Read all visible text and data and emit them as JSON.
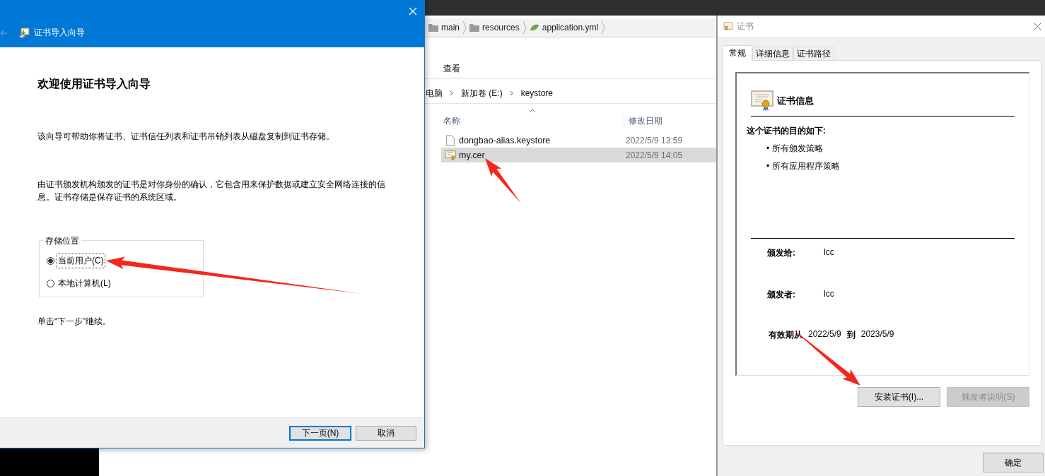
{
  "wizard": {
    "title": "证书导入向导",
    "heading": "欢迎使用证书导入向导",
    "intro": "该向导可帮助你将证书、证书信任列表和证书吊销列表从磁盘复制到证书存储。",
    "description": "由证书颁发机构颁发的证书是对你身份的确认，它包含用来保护数据或建立安全网络连接的信息。证书存储是保存证书的系统区域。",
    "store_location": {
      "label": "存储位置",
      "options": [
        {
          "label": "当前用户(C)",
          "selected": true
        },
        {
          "label": "本地计算机(L)",
          "selected": false
        }
      ]
    },
    "hint": "单击“下一步”继续。",
    "buttons": [
      {
        "label": "下一页(N)",
        "default": true
      },
      {
        "label": "取消",
        "default": false
      }
    ]
  },
  "explorer": {
    "breadcrumb": [
      "main",
      "resources",
      "application.yml"
    ],
    "menu": [
      "查看"
    ],
    "path": [
      "电脑",
      "新加卷 (E:)",
      "keystore"
    ],
    "columns": [
      "名称",
      "修改日期"
    ],
    "files": [
      {
        "name": "dongbao-alias.keystore",
        "date": "2022/5/9 13:59",
        "kind": "file",
        "selected": false
      },
      {
        "name": "my.cer",
        "date": "2022/5/9 14:05",
        "kind": "certificate",
        "selected": true
      }
    ]
  },
  "certificate": {
    "title": "证书",
    "tabs": [
      {
        "label": "常规",
        "selected": true
      },
      {
        "label": "详细信息",
        "selected": false
      },
      {
        "label": "证书路径",
        "selected": false
      }
    ],
    "info_title": "证书信息",
    "purpose_heading": "这个证书的目的如下:",
    "purposes": [
      "• 所有颁发策略",
      "• 所有应用程序策略"
    ],
    "issued_to_label": "颁发给:",
    "issued_to": "lcc",
    "issued_by_label": "颁发者:",
    "issued_by": "lcc",
    "valid_from_label": "有效期从",
    "valid_from": "2022/5/9",
    "valid_to_label": "到",
    "valid_to": "2023/5/9",
    "buttons": [
      {
        "label": "安装证书(I)...",
        "disabled": false
      },
      {
        "label": "颁发者说明(S)",
        "disabled": true
      }
    ],
    "ok_button": "确定"
  }
}
